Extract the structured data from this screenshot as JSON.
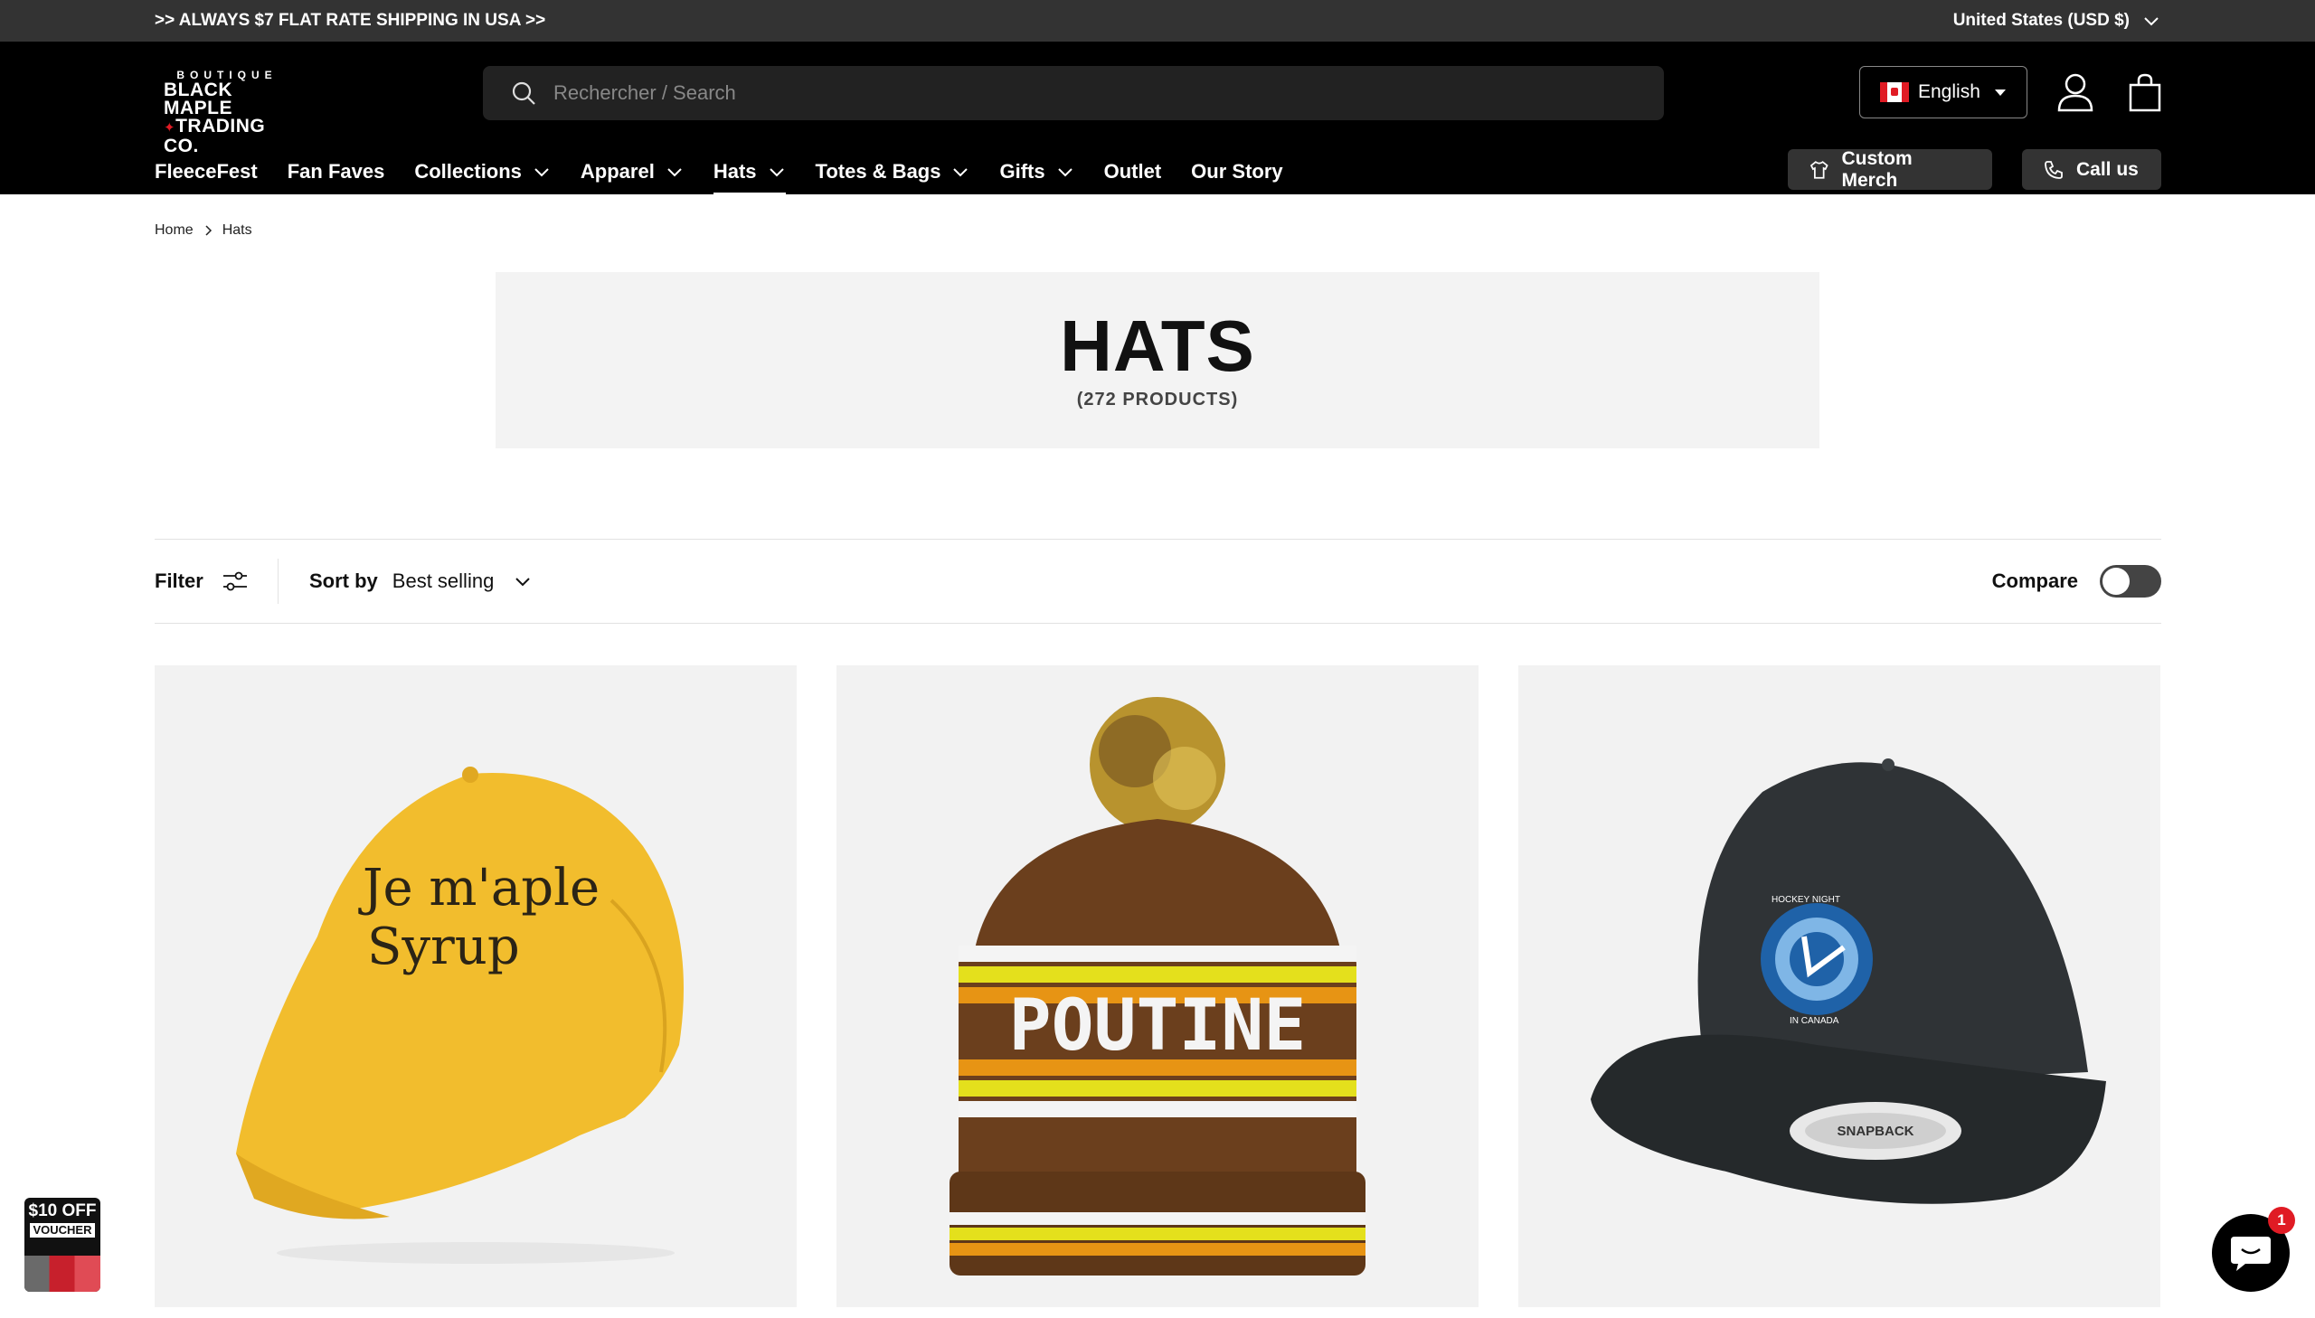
{
  "announcement": {
    "text": ">> ALWAYS $7 FLAT RATE SHIPPING IN USA >>",
    "country": "United States (USD $)"
  },
  "logo": {
    "line1": "BOUTIQUE",
    "line2": "BLACK MAPLE",
    "line3": "TRADING CO."
  },
  "search": {
    "placeholder": "Rechercher / Search"
  },
  "language": {
    "label": "English"
  },
  "nav": {
    "items": [
      {
        "label": "FleeceFest"
      },
      {
        "label": "Fan Faves"
      },
      {
        "label": "Collections"
      },
      {
        "label": "Apparel"
      },
      {
        "label": "Hats"
      },
      {
        "label": "Totes & Bags"
      },
      {
        "label": "Gifts"
      },
      {
        "label": "Outlet"
      },
      {
        "label": "Our Story"
      }
    ],
    "custom_merch": "Custom Merch",
    "call_us": "Call us"
  },
  "breadcrumb": {
    "home": "Home",
    "current": "Hats"
  },
  "hero": {
    "title": "HATS",
    "count": "(272 PRODUCTS)"
  },
  "toolbar": {
    "filter": "Filter",
    "sort_label": "Sort by",
    "sort_value": "Best selling",
    "compare": "Compare"
  },
  "products": [
    {
      "image_text": [
        "Je m'aple",
        "Syrup"
      ],
      "color": "#f2bd2d"
    },
    {
      "image_text": [
        "POUTINE"
      ],
      "color": "#6b3f1d"
    },
    {
      "image_text": [
        "HOCKEY NIGHT",
        "IN CANADA",
        "SNAPBACK"
      ],
      "color": "#2f3336"
    }
  ],
  "voucher": {
    "line1": "$10 OFF",
    "line2": "VOUCHER"
  },
  "chat": {
    "badge": "1"
  }
}
